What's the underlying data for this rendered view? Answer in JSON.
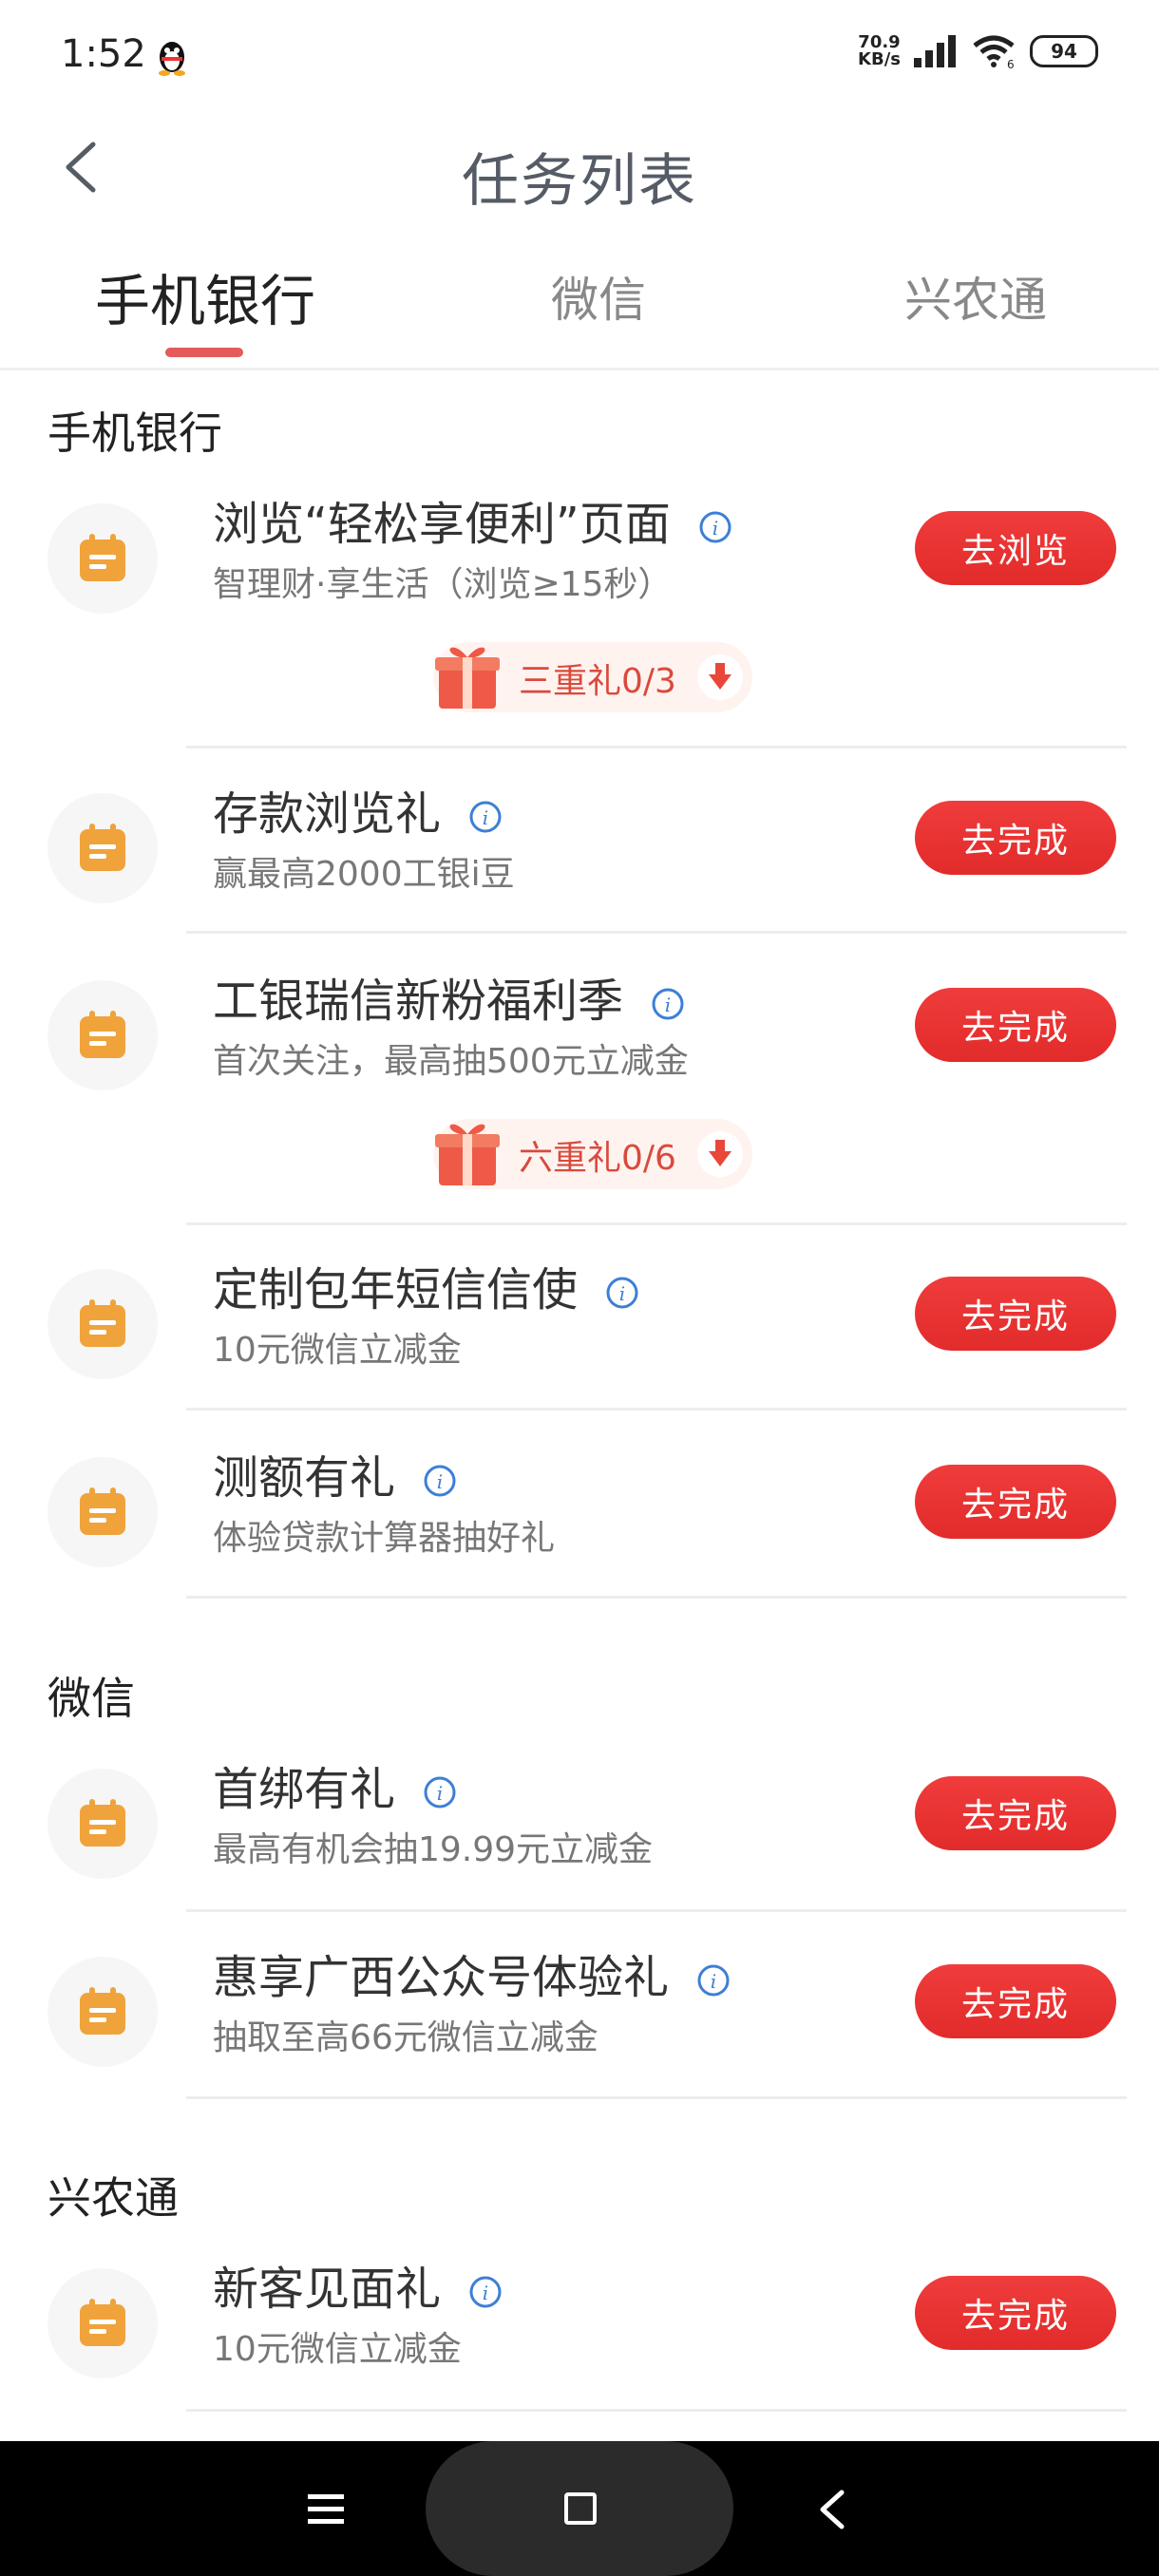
{
  "status_bar": {
    "time": "1:52",
    "net_speed_value": "70.9",
    "net_speed_unit": "KB/s",
    "battery": "94"
  },
  "header": {
    "title": "任务列表"
  },
  "tabs": [
    {
      "label": "手机银行",
      "active": true
    },
    {
      "label": "微信",
      "active": false
    },
    {
      "label": "兴农通",
      "active": false
    }
  ],
  "sections": [
    {
      "title": "手机银行",
      "tasks": [
        {
          "title": "浏览“轻松享便利”页面",
          "subtitle": "智理财·享生活（浏览≥15秒）",
          "button": "去浏览",
          "gift": "三重礼0/3"
        },
        {
          "title": "存款浏览礼",
          "subtitle": "赢最高2000工银i豆",
          "button": "去完成"
        },
        {
          "title": "工银瑞信新粉福利季",
          "subtitle": "首次关注，最高抽500元立减金",
          "button": "去完成",
          "gift": "六重礼0/6"
        },
        {
          "title": "定制包年短信信使",
          "subtitle": "10元微信立减金",
          "button": "去完成"
        },
        {
          "title": "测额有礼",
          "subtitle": "体验贷款计算器抽好礼",
          "button": "去完成"
        }
      ]
    },
    {
      "title": "微信",
      "tasks": [
        {
          "title": "首绑有礼",
          "subtitle": "最高有机会抽19.99元立减金",
          "button": "去完成"
        },
        {
          "title": "惠享广西公众号体验礼",
          "subtitle": "抽取至高66元微信立减金",
          "button": "去完成"
        }
      ]
    },
    {
      "title": "兴农通",
      "tasks": [
        {
          "title": "新客见面礼",
          "subtitle": "10元微信立减金",
          "button": "去完成"
        }
      ]
    }
  ],
  "colors": {
    "accent": "#e8302f",
    "icon_orange": "#f0a33a",
    "info_blue": "#3d7fd6",
    "tab_indicator": "#e35b5b"
  }
}
